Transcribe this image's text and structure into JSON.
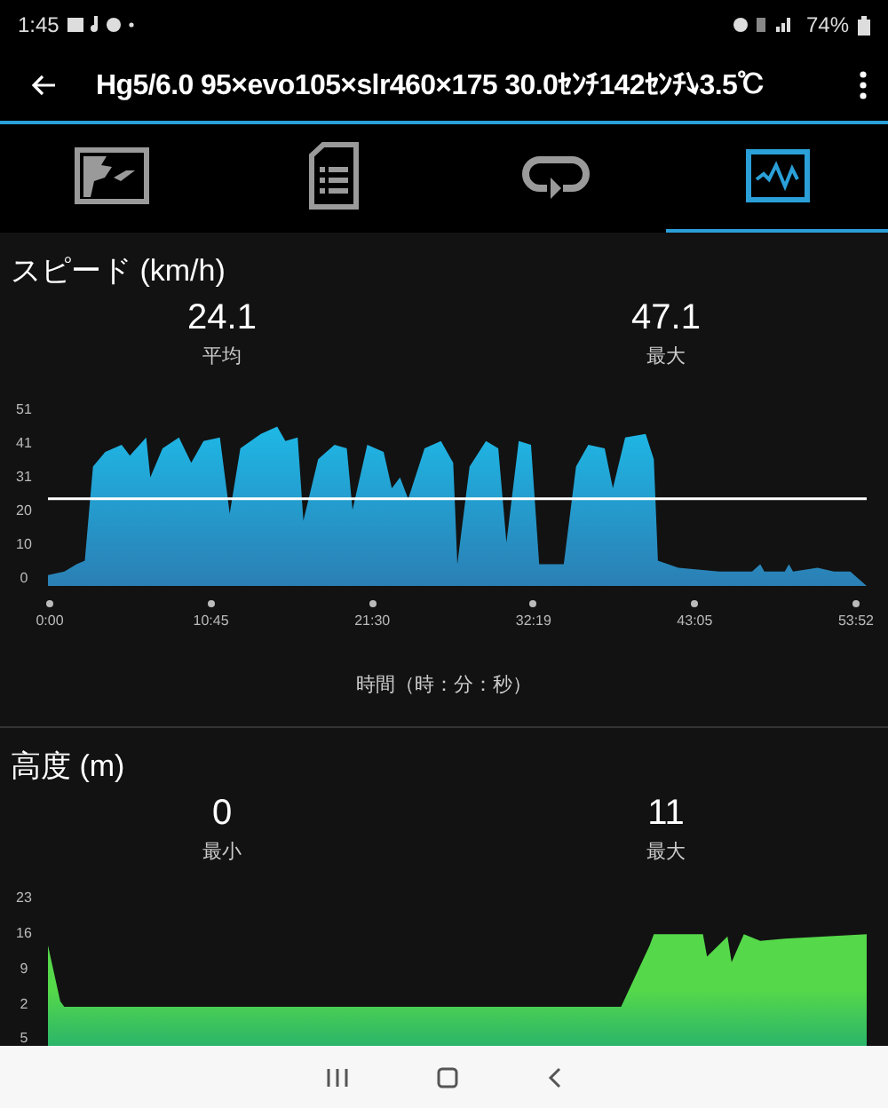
{
  "status_bar": {
    "time": "1:45",
    "battery": "74%"
  },
  "app_bar": {
    "title": "Hg5/6.0 95×evo105×slr460×175 30.0ｾﾝﾁ142ｾﾝﾁ↘3.5℃"
  },
  "tabs": [
    {
      "kind": "map",
      "selected": false
    },
    {
      "kind": "summary",
      "selected": false
    },
    {
      "kind": "laps",
      "selected": false
    },
    {
      "kind": "graph",
      "selected": true
    }
  ],
  "speed": {
    "title": "スピード (km/h)",
    "stats": [
      {
        "value": "24.1",
        "label": "平均"
      },
      {
        "value": "47.1",
        "label": "最大"
      }
    ],
    "y_labels": [
      "51",
      "41",
      "31",
      "20",
      "10",
      "0"
    ],
    "x_labels": [
      "0:00",
      "10:45",
      "21:30",
      "32:19",
      "43:05",
      "53:52"
    ],
    "x_title": "時間（時：分：秒）"
  },
  "altitude": {
    "title": "高度 (m)",
    "stats": [
      {
        "value": "0",
        "label": "最小"
      },
      {
        "value": "11",
        "label": "最大"
      }
    ],
    "y_labels": [
      "23",
      "16",
      "9",
      "2",
      "5"
    ]
  }
}
